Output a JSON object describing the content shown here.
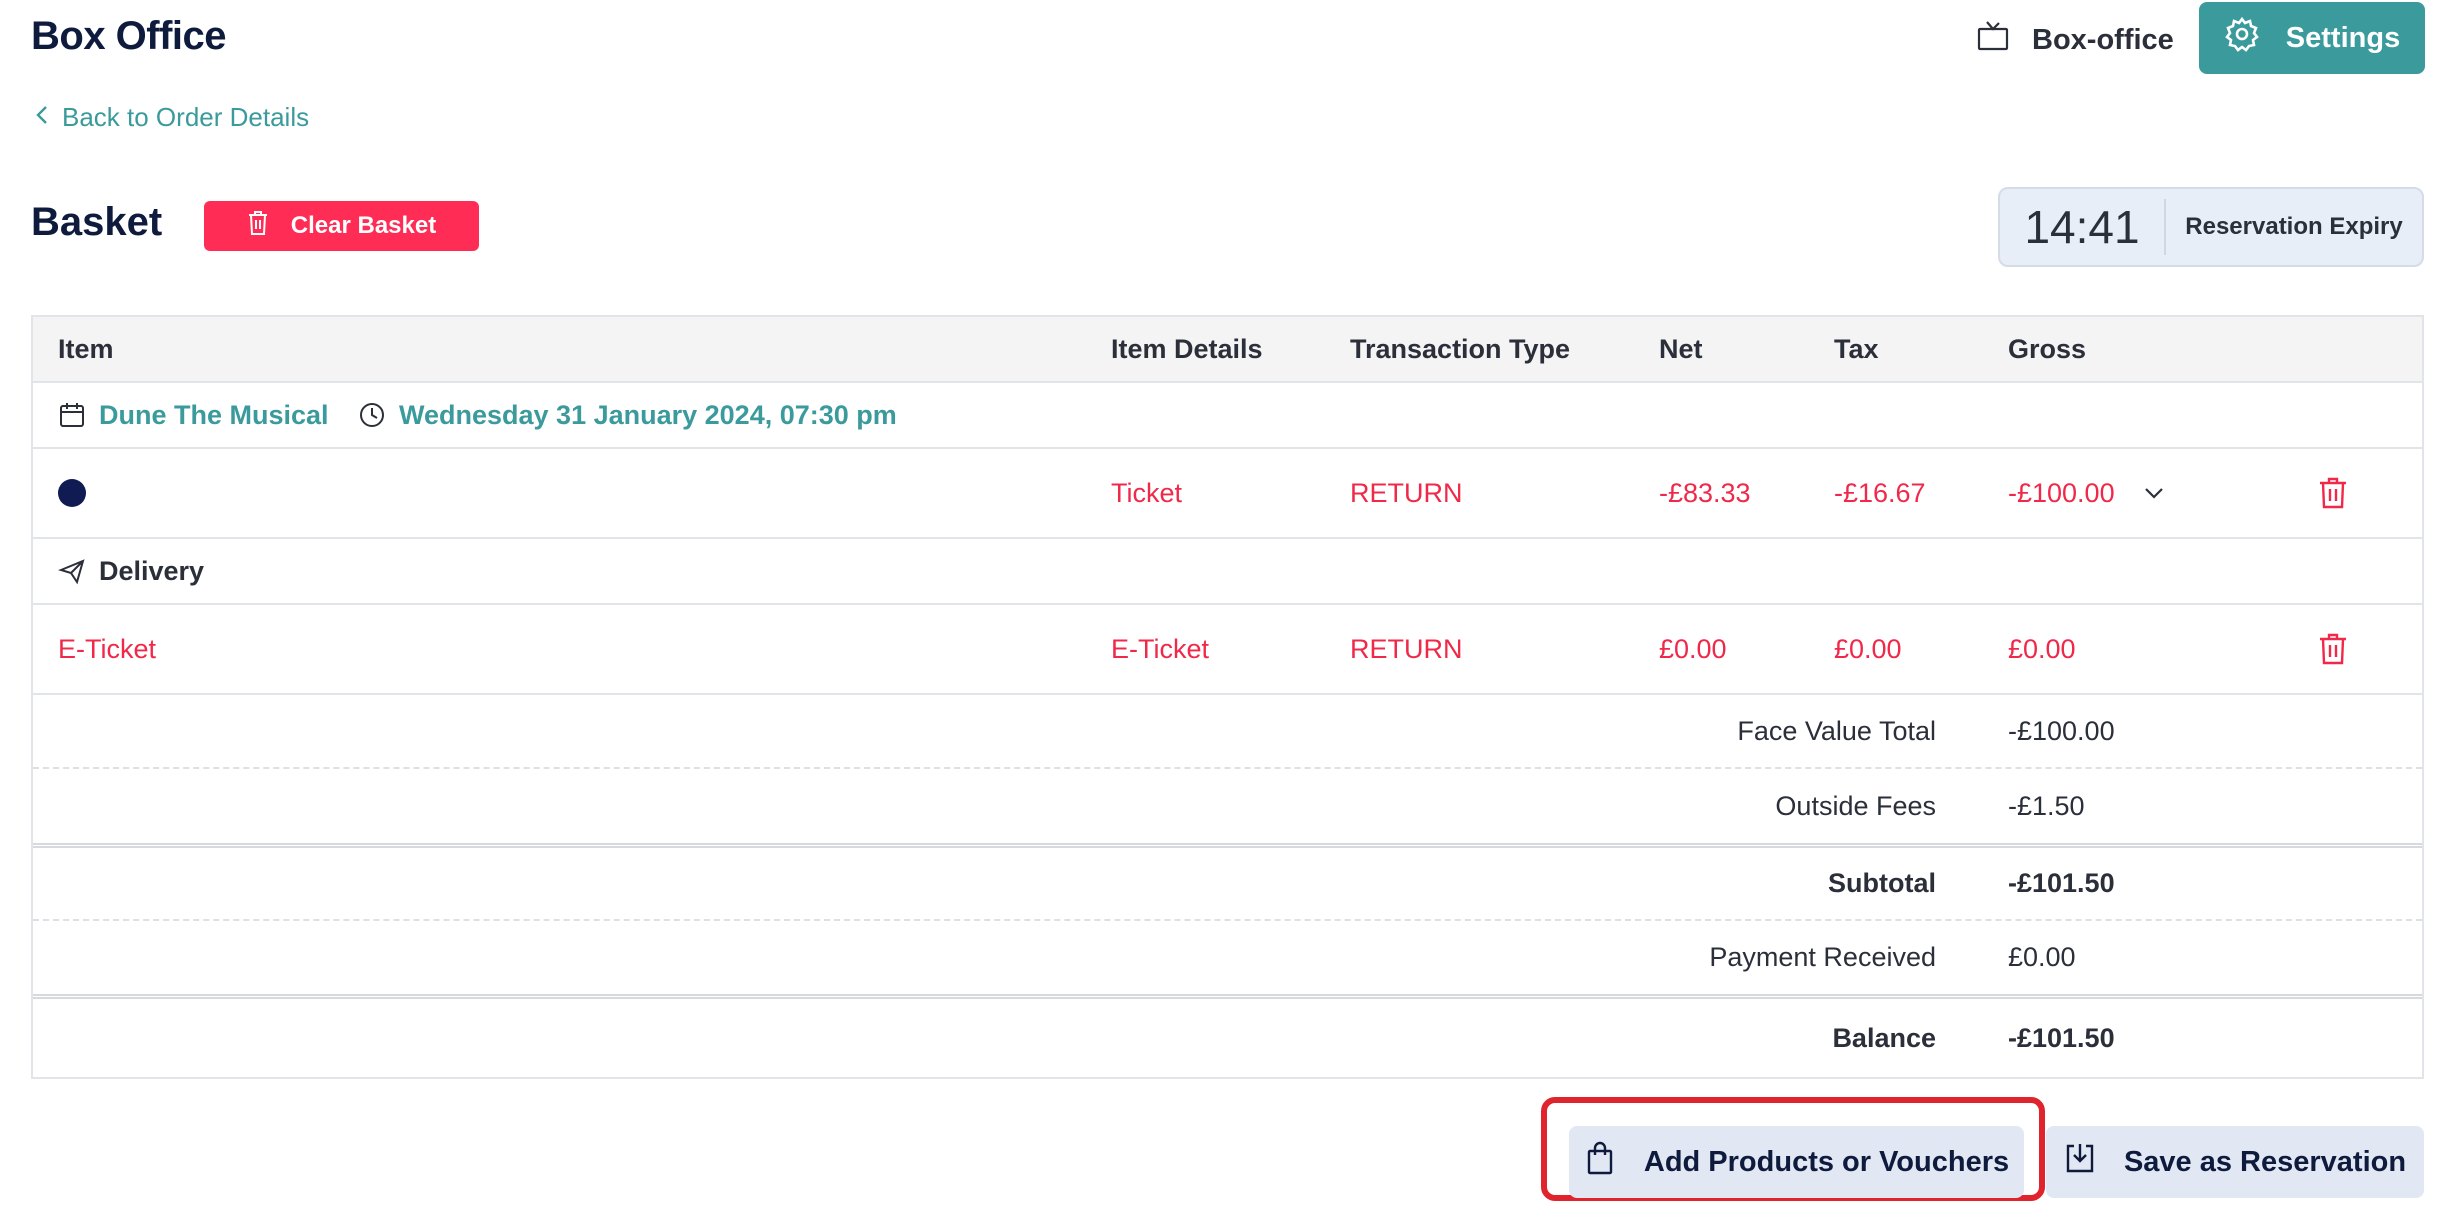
{
  "app": {
    "title": "Box Office"
  },
  "header": {
    "boxoffice_label": "Box-office",
    "settings_label": "Settings"
  },
  "nav": {
    "back_label": "Back to Order Details"
  },
  "basket": {
    "title": "Basket",
    "clear_label": "Clear Basket",
    "expiry_time": "14:41",
    "expiry_label": "Reservation Expiry"
  },
  "table": {
    "headers": [
      "Item",
      "Item Details",
      "Transaction Type",
      "Net",
      "Tax",
      "Gross"
    ],
    "event": {
      "name": "Dune The Musical",
      "datetime": "Wednesday 31 January 2024, 07:30 pm"
    },
    "ticket_row": {
      "details": "Ticket",
      "type": "RETURN",
      "net": "-£83.33",
      "tax": "-£16.67",
      "gross": "-£100.00"
    },
    "delivery_heading": "Delivery",
    "delivery_row": {
      "item": "E-Ticket",
      "details": "E-Ticket",
      "type": "RETURN",
      "net": "£0.00",
      "tax": "£0.00",
      "gross": "£0.00"
    },
    "summary": {
      "face_value_label": "Face Value Total",
      "face_value": "-£100.00",
      "outside_fees_label": "Outside Fees",
      "outside_fees": "-£1.50",
      "subtotal_label": "Subtotal",
      "subtotal": "-£101.50",
      "payment_label": "Payment Received",
      "payment": "£0.00",
      "balance_label": "Balance",
      "balance": "-£101.50"
    }
  },
  "actions": {
    "add_label": "Add Products or Vouchers",
    "save_label": "Save as Reservation"
  },
  "colors": {
    "accent": "#3a9a9c",
    "danger": "#ff2d55",
    "highlight": "#e0242e",
    "navy": "#0f1b3d"
  }
}
